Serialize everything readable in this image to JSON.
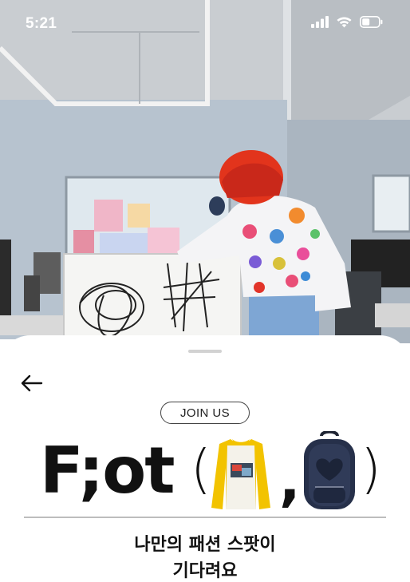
{
  "status_bar": {
    "time": "5:21",
    "icons": [
      "signal-icon",
      "wifi-icon",
      "battery-icon"
    ]
  },
  "hero": {
    "image_subject": "person with red hair in a white patterned shirt drawing on a board in an office"
  },
  "sheet": {
    "back_icon": "back-arrow-icon",
    "join_label": "JOIN US",
    "brand": {
      "word": "F;ot",
      "open_paren": "(",
      "comma": ",",
      "close_paren": ")",
      "item_icons": [
        "shirt-icon",
        "backpack-icon"
      ]
    },
    "headline_line1": "나만의 패션 스팟이",
    "headline_line2": "기다려요"
  },
  "colors": {
    "sheet_bg": "#ffffff",
    "text": "#111111",
    "hair": "#e2341c",
    "shirt_sleeve": "#f2c300"
  }
}
